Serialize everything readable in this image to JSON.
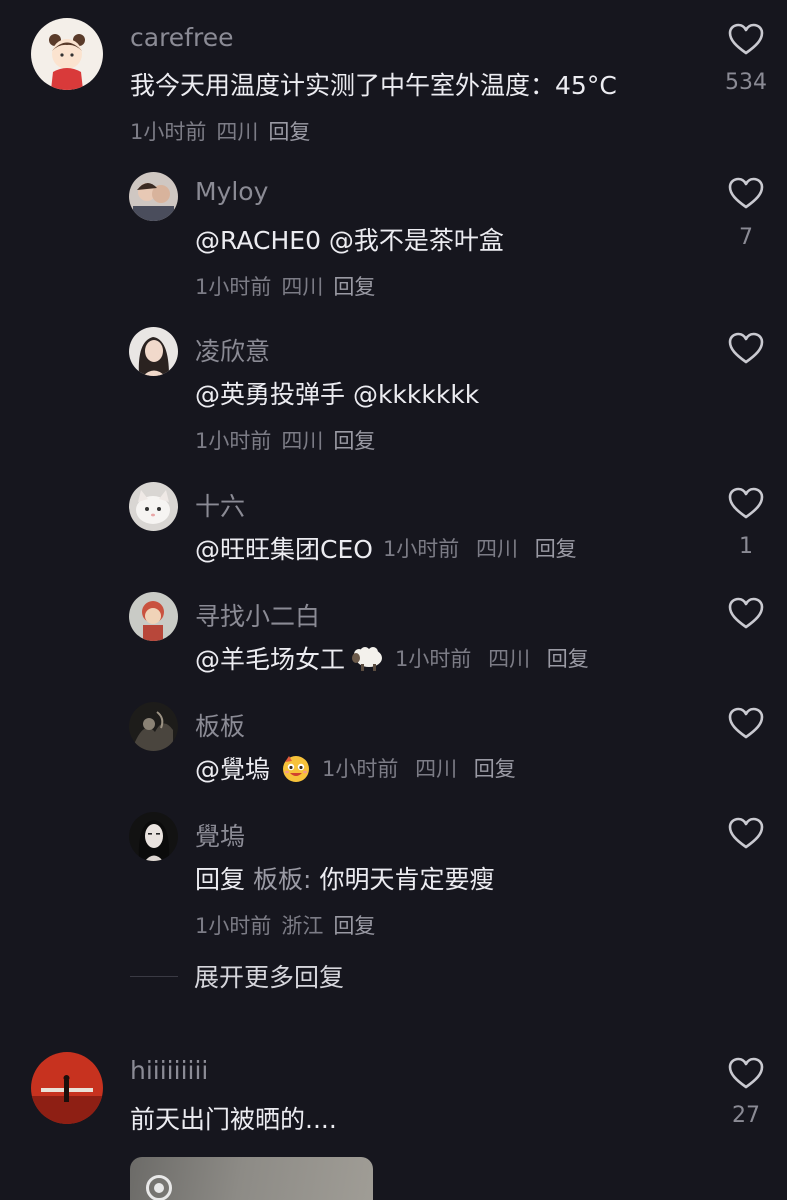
{
  "colors": {
    "background": "#16161e",
    "username": "#8b8b95",
    "text": "#ececf1",
    "meta": "#7c7c86"
  },
  "comments": [
    {
      "username": "carefree",
      "text": "我今天用温度计实测了中午室外温度：45°C",
      "time": "1小时前",
      "location": "四川",
      "reply_label": "回复",
      "likes": "534",
      "replies": [
        {
          "username": "Myloy",
          "text": "@RACHE0 @我不是茶叶盒",
          "time": "1小时前",
          "location": "四川",
          "reply_label": "回复",
          "likes": "7"
        },
        {
          "username": "凌欣意",
          "text": "@英勇投弹手 @kkkkkkk",
          "time": "1小时前",
          "location": "四川",
          "reply_label": "回复",
          "likes": ""
        },
        {
          "username": "十六",
          "text": "@旺旺集团CEO",
          "time": "1小时前",
          "location": "四川",
          "reply_label": "回复",
          "likes": "1"
        },
        {
          "username": "寻找小二白",
          "text": "@羊毛场女工",
          "emoji": "sheep-emoji",
          "time": "1小时前",
          "location": "四川",
          "reply_label": "回复",
          "likes": ""
        },
        {
          "username": "板板",
          "text": "@覺塢",
          "emoji": "smiling-face-emoji",
          "time": "1小时前",
          "location": "四川",
          "reply_label": "回复",
          "likes": ""
        },
        {
          "username": "覺塢",
          "reply_prefix": "回复",
          "reply_target": "板板:",
          "text": "你明天肯定要瘦",
          "time": "1小时前",
          "location": "浙江",
          "reply_label": "回复",
          "likes": ""
        }
      ],
      "expand_label": "展开更多回复"
    },
    {
      "username": "hiiiiiiiii",
      "text": "前天出门被晒的....",
      "likes": "27"
    }
  ]
}
